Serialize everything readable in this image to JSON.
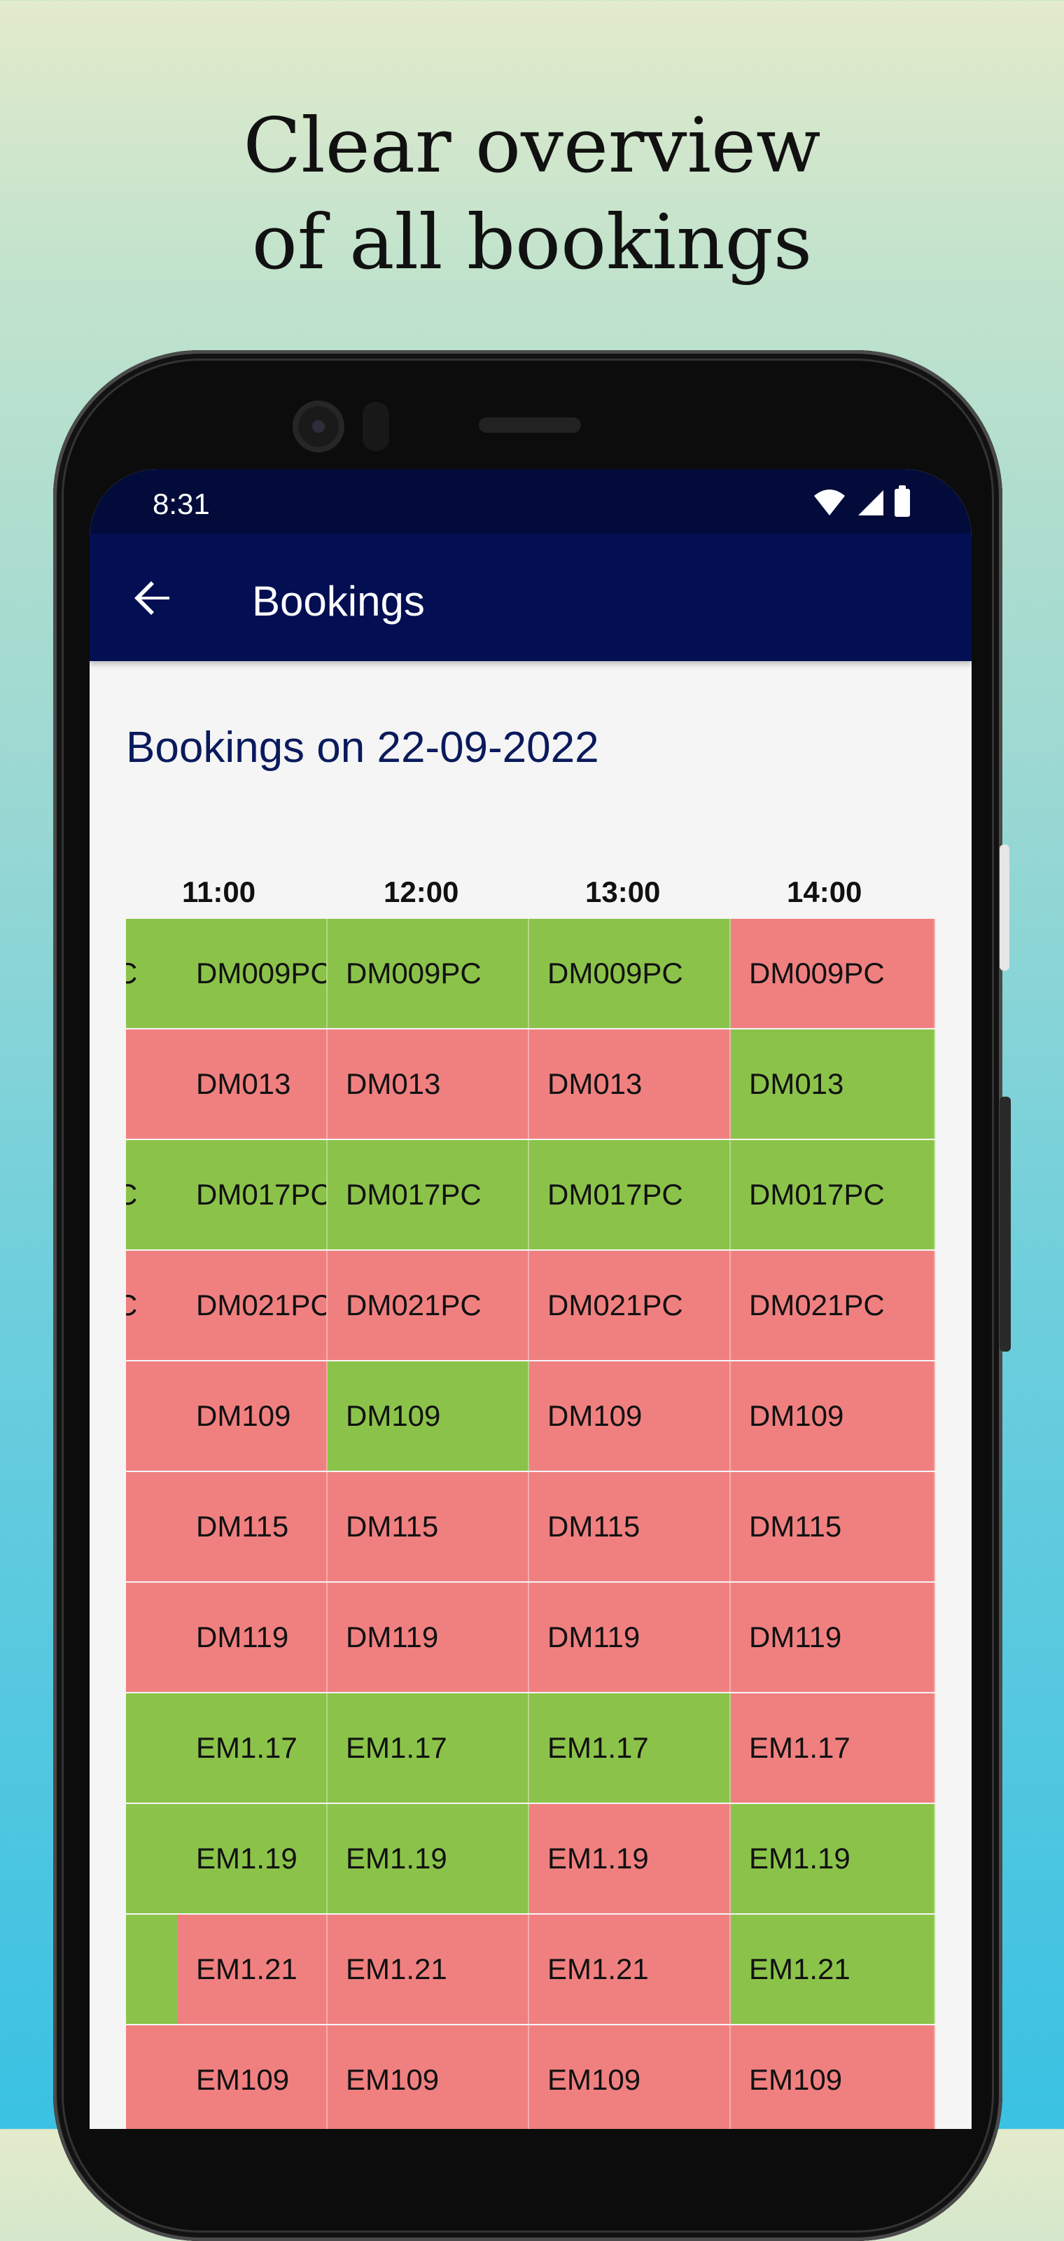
{
  "headline": {
    "line1": "Clear overview",
    "line2": "of all bookings"
  },
  "statusbar": {
    "time": "8:31",
    "icons": [
      "wifi-icon",
      "signal-icon",
      "battery-icon"
    ]
  },
  "appbar": {
    "back_icon": "arrow-back-icon",
    "title": "Bookings"
  },
  "page": {
    "subtitle": "Bookings on 22-09-2022"
  },
  "colors": {
    "available": "#8bc34a",
    "booked": "#f08080",
    "appbar": "#030f52",
    "statusbar": "#030b3a"
  },
  "timeline": {
    "hours": [
      "11:00",
      "12:00",
      "13:00",
      "14:00"
    ]
  },
  "rows": [
    {
      "room": "DM009PC",
      "cells": [
        {
          "label": "C",
          "status": "g"
        },
        {
          "label": "DM009PC",
          "status": "g"
        },
        {
          "label": "DM009PC",
          "status": "g"
        },
        {
          "label": "DM009PC",
          "status": "g"
        },
        {
          "label": "DM009PC",
          "status": "r"
        }
      ]
    },
    {
      "room": "DM013",
      "cells": [
        {
          "label": "",
          "status": "r"
        },
        {
          "label": "DM013",
          "status": "r"
        },
        {
          "label": "DM013",
          "status": "r"
        },
        {
          "label": "DM013",
          "status": "r"
        },
        {
          "label": "DM013",
          "status": "g"
        }
      ]
    },
    {
      "room": "DM017PC",
      "cells": [
        {
          "label": "C",
          "status": "g"
        },
        {
          "label": "DM017PC",
          "status": "g"
        },
        {
          "label": "DM017PC",
          "status": "g"
        },
        {
          "label": "DM017PC",
          "status": "g"
        },
        {
          "label": "DM017PC",
          "status": "g"
        }
      ]
    },
    {
      "room": "DM021PC",
      "cells": [
        {
          "label": "C",
          "status": "r"
        },
        {
          "label": "DM021PC",
          "status": "r"
        },
        {
          "label": "DM021PC",
          "status": "r"
        },
        {
          "label": "DM021PC",
          "status": "r"
        },
        {
          "label": "DM021PC",
          "status": "r"
        }
      ]
    },
    {
      "room": "DM109",
      "cells": [
        {
          "label": "",
          "status": "r"
        },
        {
          "label": "DM109",
          "status": "r"
        },
        {
          "label": "DM109",
          "status": "g"
        },
        {
          "label": "DM109",
          "status": "r"
        },
        {
          "label": "DM109",
          "status": "r"
        }
      ]
    },
    {
      "room": "DM115",
      "cells": [
        {
          "label": "",
          "status": "r"
        },
        {
          "label": "DM115",
          "status": "r"
        },
        {
          "label": "DM115",
          "status": "r"
        },
        {
          "label": "DM115",
          "status": "r"
        },
        {
          "label": "DM115",
          "status": "r"
        }
      ]
    },
    {
      "room": "DM119",
      "cells": [
        {
          "label": "",
          "status": "r"
        },
        {
          "label": "DM119",
          "status": "r"
        },
        {
          "label": "DM119",
          "status": "r"
        },
        {
          "label": "DM119",
          "status": "r"
        },
        {
          "label": "DM119",
          "status": "r"
        }
      ]
    },
    {
      "room": "EM1.17",
      "cells": [
        {
          "label": "",
          "status": "g"
        },
        {
          "label": "EM1.17",
          "status": "g"
        },
        {
          "label": "EM1.17",
          "status": "g"
        },
        {
          "label": "EM1.17",
          "status": "g"
        },
        {
          "label": "EM1.17",
          "status": "r"
        }
      ]
    },
    {
      "room": "EM1.19",
      "cells": [
        {
          "label": "",
          "status": "g"
        },
        {
          "label": "EM1.19",
          "status": "g"
        },
        {
          "label": "EM1.19",
          "status": "g"
        },
        {
          "label": "EM1.19",
          "status": "r"
        },
        {
          "label": "EM1.19",
          "status": "g"
        }
      ]
    },
    {
      "room": "EM1.21",
      "cells": [
        {
          "label": "",
          "status": "g"
        },
        {
          "label": "EM1.21",
          "status": "r"
        },
        {
          "label": "EM1.21",
          "status": "r"
        },
        {
          "label": "EM1.21",
          "status": "r"
        },
        {
          "label": "EM1.21",
          "status": "g"
        }
      ]
    },
    {
      "room": "EM109",
      "cells": [
        {
          "label": "",
          "status": "r"
        },
        {
          "label": "EM109",
          "status": "r"
        },
        {
          "label": "EM109",
          "status": "r"
        },
        {
          "label": "EM109",
          "status": "r"
        },
        {
          "label": "EM109",
          "status": "r"
        }
      ]
    }
  ]
}
